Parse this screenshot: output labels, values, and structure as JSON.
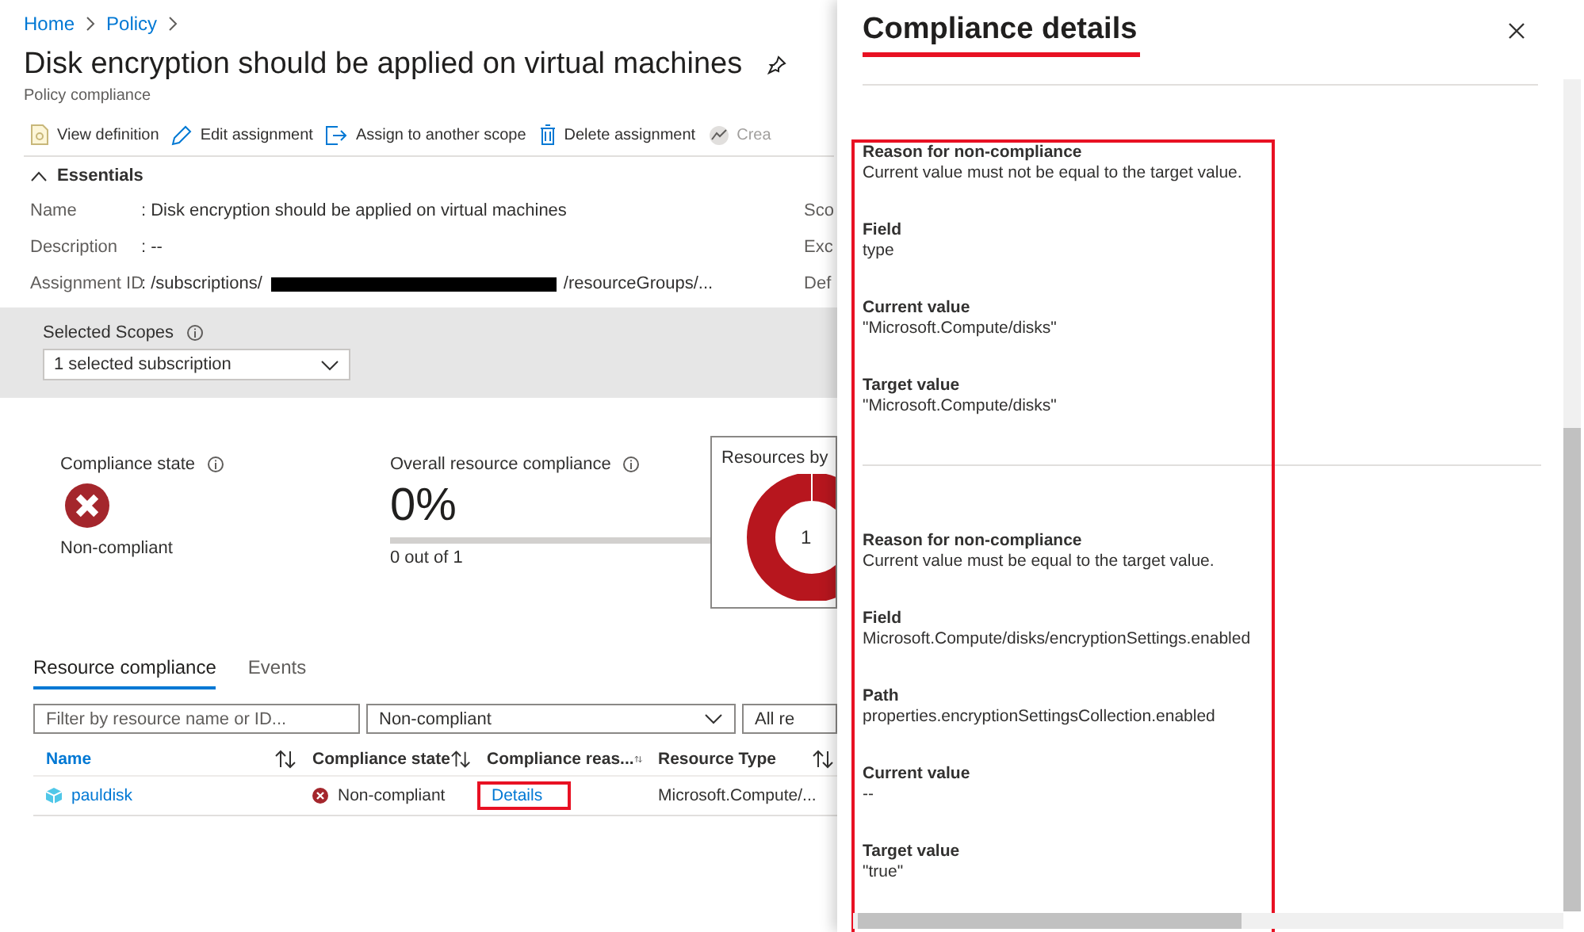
{
  "breadcrumb": [
    "Home",
    "Policy"
  ],
  "title": "Disk encryption should be applied on virtual machines",
  "subtitle": "Policy compliance",
  "toolbar": [
    {
      "kind": "document",
      "label": "View definition",
      "disabled": false
    },
    {
      "kind": "pencil",
      "label": "Edit assignment",
      "disabled": false
    },
    {
      "kind": "export",
      "label": "Assign to another scope",
      "disabled": false
    },
    {
      "kind": "trash",
      "label": "Delete assignment",
      "disabled": false
    },
    {
      "kind": "chart",
      "label": "Crea",
      "disabled": true
    }
  ],
  "essentials": {
    "label": "Essentials",
    "expanded": true,
    "rows": [
      {
        "label": "Name",
        "value": ": Disk encryption should be applied on virtual machines",
        "side_label": "Sco"
      },
      {
        "label": "Description",
        "value": ": --",
        "side_label": "Exc"
      },
      {
        "label": "Assignment ID",
        "value": ": /subscriptions/",
        "redacted": true,
        "value_after": "/resourceGroups/...",
        "side_label": "Def"
      }
    ]
  },
  "scopes": {
    "label": "Selected Scopes",
    "value": "1 selected subscription"
  },
  "compliance_state": {
    "label": "Compliance state",
    "state": "Non-compliant"
  },
  "overall": {
    "label": "Overall resource compliance",
    "value": "0%",
    "level": 0,
    "caption": "0 out of 1"
  },
  "resources_card": {
    "title": "Resources by",
    "center": "1"
  },
  "tabs": [
    {
      "label": "Resource compliance",
      "selected": true
    },
    {
      "label": "Events",
      "selected": false
    }
  ],
  "filters": {
    "search": {
      "placeholder": "Filter by resource name or ID..."
    },
    "state": "Non-compliant",
    "type": "All re"
  },
  "table": {
    "columns": [
      {
        "label": "Name",
        "link": true
      },
      {
        "label": "Compliance state",
        "link": false
      },
      {
        "label": "Compliance reas...",
        "link": false
      },
      {
        "label": "Resource Type",
        "link": false
      }
    ],
    "rows": [
      {
        "name": "pauldisk",
        "state": "Non-compliant",
        "reason": "Details",
        "reason_highlighted": true,
        "type": "Microsoft.Compute/..."
      }
    ]
  },
  "panel": {
    "title": "Compliance details",
    "title_highlighted": true,
    "highlighted": true,
    "groups": [
      {
        "entries": [
          {
            "label": "Reason for non-compliance",
            "value": "Current value must not be equal to the target value."
          },
          {
            "label": "Field",
            "value": "type"
          },
          {
            "label": "Current value",
            "value": "\"Microsoft.Compute/disks\""
          },
          {
            "label": "Target value",
            "value": "\"Microsoft.Compute/disks\""
          }
        ]
      },
      {
        "entries": [
          {
            "label": "Reason for non-compliance",
            "value": "Current value must be equal to the target value."
          },
          {
            "label": "Field",
            "value": "Microsoft.Compute/disks/encryptionSettings.enabled"
          },
          {
            "label": "Path",
            "value": "properties.encryptionSettingsCollection.enabled"
          },
          {
            "label": "Current value",
            "value": "--"
          },
          {
            "label": "Target value",
            "value": "\"true\""
          }
        ]
      }
    ]
  }
}
